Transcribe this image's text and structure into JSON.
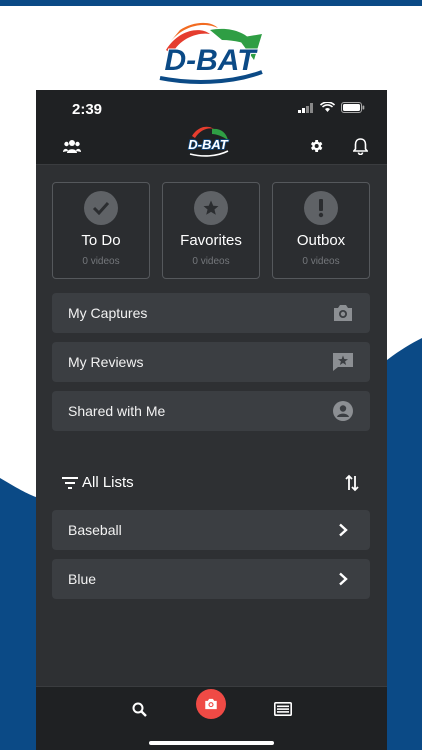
{
  "brand": {
    "logo_text": "D-BAT",
    "colors": {
      "navy": "#0b4a86",
      "dark": "#1f2123",
      "panel": "#3b3e42",
      "accent": "#ef4a45"
    }
  },
  "status": {
    "time": "2:39"
  },
  "nav": {
    "left_icon": "team-icon",
    "right_icons": [
      "gear-icon",
      "bell-icon"
    ]
  },
  "tiles": [
    {
      "label": "To Do",
      "count": "0 videos",
      "icon": "check-icon"
    },
    {
      "label": "Favorites",
      "count": "0 videos",
      "icon": "star-icon"
    },
    {
      "label": "Outbox",
      "count": "0 videos",
      "icon": "exclamation-icon"
    }
  ],
  "rows": [
    {
      "label": "My Captures",
      "icon": "camera-icon"
    },
    {
      "label": "My Reviews",
      "icon": "review-icon"
    },
    {
      "label": "Shared with Me",
      "icon": "person-icon"
    }
  ],
  "lists": {
    "title": "All Lists",
    "items": [
      {
        "label": "Baseball"
      },
      {
        "label": "Blue"
      }
    ]
  },
  "tabbar": {
    "icons": [
      "search-icon",
      "camera-icon",
      "list-icon"
    ]
  }
}
